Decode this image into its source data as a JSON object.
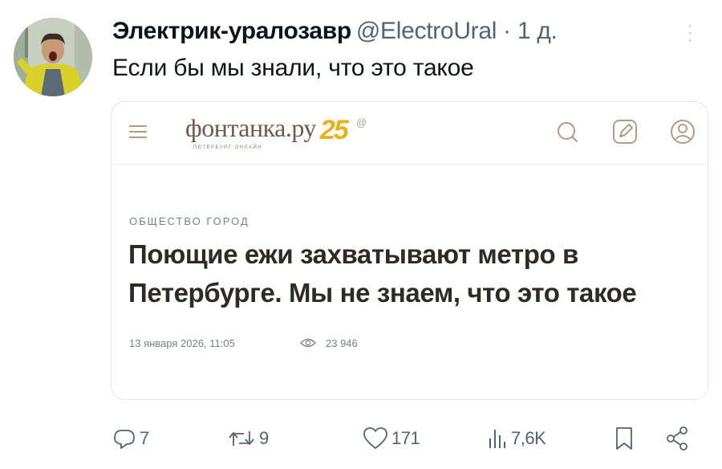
{
  "tweet": {
    "author_name": "Электрик-уралозавр",
    "author_handle": "@ElectroUral",
    "separator": "·",
    "time_ago": "1 д.",
    "text": "Если бы мы знали, что это такое"
  },
  "card": {
    "logo": {
      "site_name": "фонтанка.ру",
      "tagline": "ПЕТЕРБУРГ ОНЛАЙН",
      "badge_number": "25",
      "badge_mark": "@"
    },
    "header_icons": [
      "menu-icon",
      "search-icon",
      "edit-icon",
      "profile-icon"
    ],
    "rubric": "ОБЩЕСТВО ГОРОД",
    "headline": "Поющие ежи захватывают метро в Петербурге. Мы не знаем, что это такое",
    "date": "13 января 2026, 11:05",
    "views": "23 946"
  },
  "actions": {
    "replies": "7",
    "retweets": "9",
    "likes": "171",
    "views": "7,6K"
  },
  "colors": {
    "text_primary": "#0f1419",
    "text_secondary": "#536471",
    "card_border": "#e4e8ec",
    "headline": "#2e2a27",
    "logo_brown": "#6d5a4e",
    "logo_accent": "#e8b21c",
    "icon_tan": "#b39b8a"
  }
}
